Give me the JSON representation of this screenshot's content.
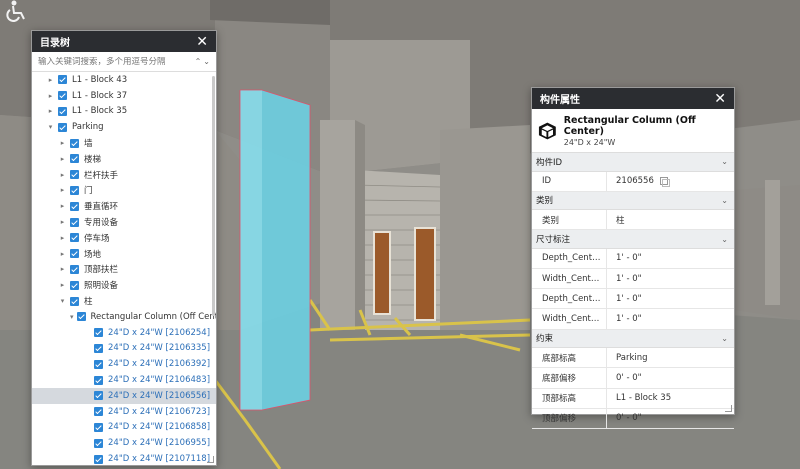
{
  "tree_panel": {
    "title": "目录树",
    "close_label": "✕",
    "search_placeholder": "输入关键词搜索，多个用逗号分隔",
    "search_arrows": "⌃⌄",
    "rows": [
      {
        "label": "L1 - Block 43",
        "expanded": false,
        "level": 1
      },
      {
        "label": "L1 - Block 37",
        "expanded": false,
        "level": 1
      },
      {
        "label": "L1 - Block 35",
        "expanded": false,
        "level": 1
      },
      {
        "label": "Parking",
        "expanded": true,
        "level": 1
      },
      {
        "label": "墙",
        "expanded": false,
        "level": 2
      },
      {
        "label": "楼梯",
        "expanded": false,
        "level": 2
      },
      {
        "label": "栏杆扶手",
        "expanded": false,
        "level": 2
      },
      {
        "label": "门",
        "expanded": false,
        "level": 2
      },
      {
        "label": "垂直循环",
        "expanded": false,
        "level": 2
      },
      {
        "label": "专用设备",
        "expanded": false,
        "level": 2
      },
      {
        "label": "停车场",
        "expanded": false,
        "level": 2
      },
      {
        "label": "场地",
        "expanded": false,
        "level": 2
      },
      {
        "label": "顶部扶栏",
        "expanded": false,
        "level": 2
      },
      {
        "label": "照明设备",
        "expanded": false,
        "level": 2
      },
      {
        "label": "柱",
        "expanded": true,
        "level": 2
      },
      {
        "label": "Rectangular Column (Off Center)",
        "expanded": true,
        "level": 3
      },
      {
        "label": "24\"D x 24\"W [2106254]",
        "level": 4,
        "blue": true
      },
      {
        "label": "24\"D x 24\"W [2106335]",
        "level": 4,
        "blue": true
      },
      {
        "label": "24\"D x 24\"W [2106392]",
        "level": 4,
        "blue": true
      },
      {
        "label": "24\"D x 24\"W [2106483]",
        "level": 4,
        "blue": true
      },
      {
        "label": "24\"D x 24\"W [2106556]",
        "level": 4,
        "blue": true,
        "selected": true
      },
      {
        "label": "24\"D x 24\"W [2106723]",
        "level": 4,
        "blue": true
      },
      {
        "label": "24\"D x 24\"W [2106858]",
        "level": 4,
        "blue": true
      },
      {
        "label": "24\"D x 24\"W [2106955]",
        "level": 4,
        "blue": true
      },
      {
        "label": "24\"D x 24\"W [2107118]",
        "level": 4,
        "blue": true
      }
    ]
  },
  "prop_panel": {
    "title": "构件属性",
    "close_label": "✕",
    "element_name": "Rectangular Column (Off Center)",
    "element_type": "24\"D x 24\"W",
    "sections": [
      {
        "title": "构件ID",
        "rows": [
          {
            "key": "ID",
            "value": "2106556",
            "copy": true
          }
        ]
      },
      {
        "title": "类别",
        "rows": [
          {
            "key": "类别",
            "value": "柱"
          }
        ]
      },
      {
        "title": "尺寸标注",
        "rows": [
          {
            "key": "Depth_Cent…",
            "value": "1' - 0\""
          },
          {
            "key": "Width_Cent…",
            "value": "1' - 0\""
          },
          {
            "key": "Depth_Cent…",
            "value": "1' - 0\""
          },
          {
            "key": "Width_Cent…",
            "value": "1' - 0\""
          }
        ]
      },
      {
        "title": "约束",
        "rows": [
          {
            "key": "底部标高",
            "value": "Parking"
          },
          {
            "key": "底部偏移",
            "value": "0' - 0\""
          },
          {
            "key": "顶部标高",
            "value": "L1 - Block 35"
          },
          {
            "key": "顶部偏移",
            "value": "0' - 0\""
          }
        ]
      }
    ]
  },
  "colors": {
    "header_bg": "#2b2d31",
    "checkbox": "#2c86d6",
    "selected_row": "#d5d9de",
    "highlight_column": "#7fe0f0",
    "parking_line": "#d9c34a"
  }
}
